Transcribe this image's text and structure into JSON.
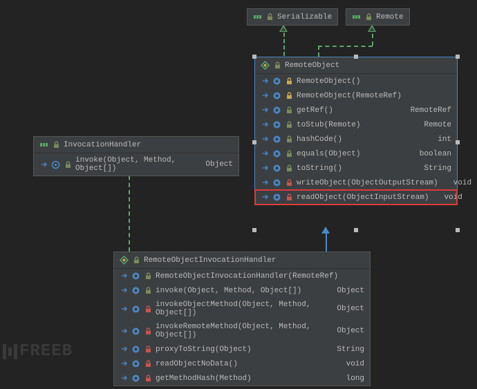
{
  "interfaces": {
    "serializable": {
      "name": "Serializable"
    },
    "remote": {
      "name": "Remote"
    },
    "invocationHandler": {
      "name": "InvocationHandler",
      "members": [
        {
          "sig": "invoke(Object, Method, Object[])",
          "ret": "Object"
        }
      ]
    }
  },
  "classes": {
    "remoteObject": {
      "name": "RemoteObject",
      "members": [
        {
          "sig": "RemoteObject()",
          "ret": "",
          "kind": "ctor",
          "access": "protected"
        },
        {
          "sig": "RemoteObject(RemoteRef)",
          "ret": "",
          "kind": "ctor",
          "access": "protected"
        },
        {
          "sig": "getRef()",
          "ret": "RemoteRef",
          "kind": "method",
          "access": "public"
        },
        {
          "sig": "toStub(Remote)",
          "ret": "Remote",
          "kind": "method",
          "access": "public"
        },
        {
          "sig": "hashCode()",
          "ret": "int",
          "kind": "method",
          "access": "public"
        },
        {
          "sig": "equals(Object)",
          "ret": "boolean",
          "kind": "method",
          "access": "public"
        },
        {
          "sig": "toString()",
          "ret": "String",
          "kind": "method",
          "access": "public"
        },
        {
          "sig": "writeObject(ObjectOutputStream)",
          "ret": "void",
          "kind": "method",
          "access": "private"
        },
        {
          "sig": "readObject(ObjectInputStream)",
          "ret": "void",
          "kind": "method",
          "access": "private",
          "highlight": true
        }
      ]
    },
    "remoteObjectInvocationHandler": {
      "name": "RemoteObjectInvocationHandler",
      "members": [
        {
          "sig": "RemoteObjectInvocationHandler(RemoteRef)",
          "ret": "",
          "kind": "ctor",
          "access": "public"
        },
        {
          "sig": "invoke(Object, Method, Object[])",
          "ret": "Object",
          "kind": "method",
          "access": "public"
        },
        {
          "sig": "invokeObjectMethod(Object, Method, Object[])",
          "ret": "Object",
          "kind": "method",
          "access": "private"
        },
        {
          "sig": "invokeRemoteMethod(Object, Method, Object[])",
          "ret": "Object",
          "kind": "method",
          "access": "private"
        },
        {
          "sig": "proxyToString(Object)",
          "ret": "String",
          "kind": "method",
          "access": "private"
        },
        {
          "sig": "readObjectNoData()",
          "ret": "void",
          "kind": "method",
          "access": "private"
        },
        {
          "sig": "getMethodHash(Method)",
          "ret": "long",
          "kind": "method",
          "access": "private"
        }
      ]
    }
  },
  "watermark": "FREEB"
}
